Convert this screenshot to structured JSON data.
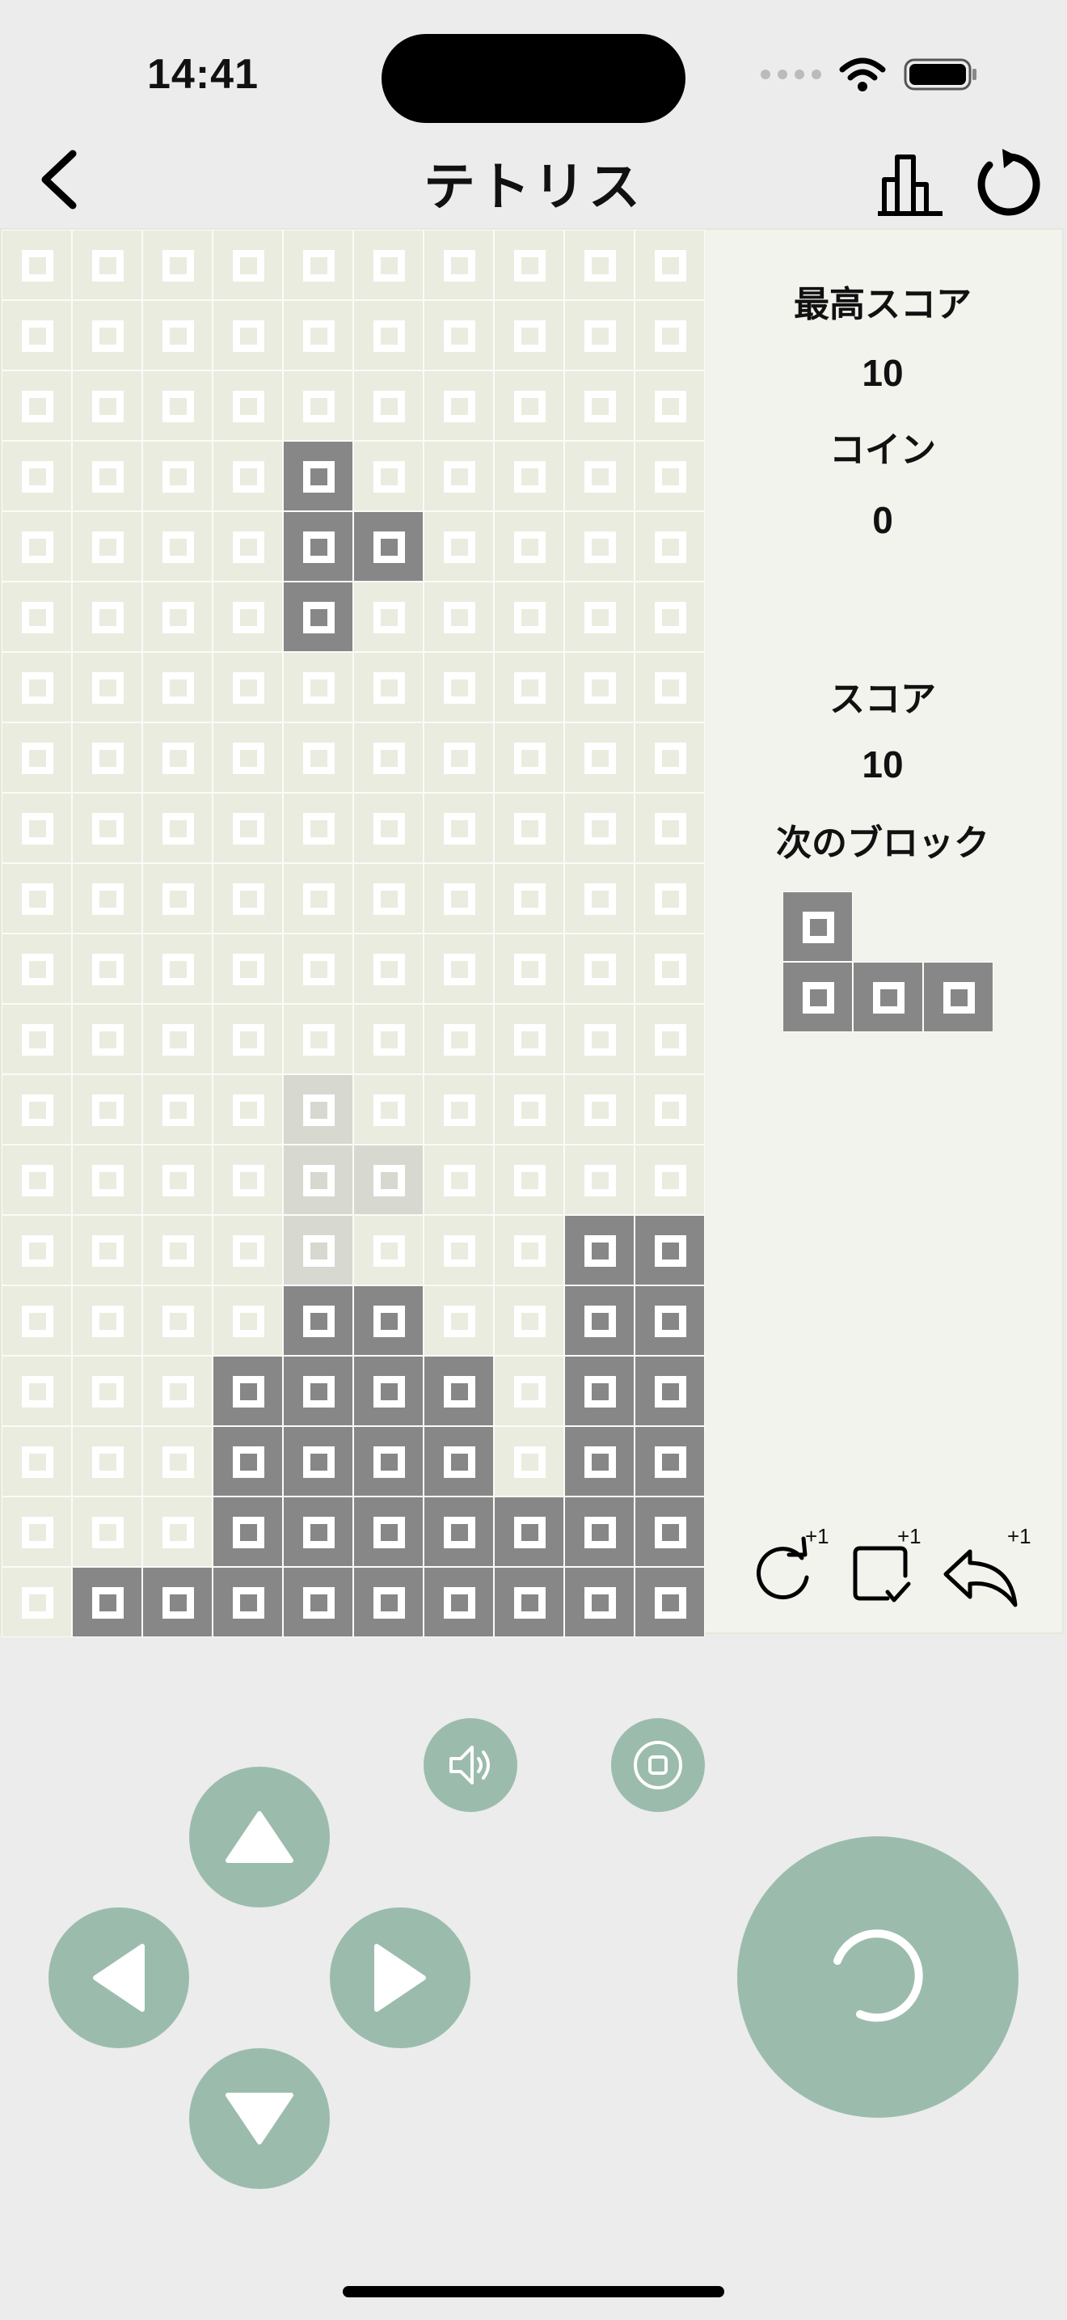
{
  "status": {
    "time": "14:41"
  },
  "nav": {
    "title": "テトリス",
    "back_icon": "chevron-left-icon",
    "stats_icon": "bar-chart-icon",
    "restart_icon": "restart-icon"
  },
  "side": {
    "best_label": "最高スコア",
    "best_value": "10",
    "coin_label": "コイン",
    "coin_value": "0",
    "score_label": "スコア",
    "score_value": "10",
    "next_label": "次のブロック"
  },
  "board": {
    "columns": 10,
    "rows": 20,
    "legend": {
      ".": "empty",
      "#": "filled",
      "g": "ghost"
    },
    "grid": [
      "..........",
      "..........",
      "..........",
      "....#.....",
      "....##....",
      "....#.....",
      "..........",
      "..........",
      "..........",
      "..........",
      "..........",
      "..........",
      "....g.....",
      "....gg....",
      "....g...##",
      "....##..##",
      "...####.##",
      "...####.##",
      "...#######",
      ".#########"
    ]
  },
  "next_piece": {
    "grid": [
      "#..",
      "###"
    ]
  },
  "powerups": [
    {
      "icon": "rotate-icon",
      "badge": "+1"
    },
    {
      "icon": "check-square-icon",
      "badge": "+1"
    },
    {
      "icon": "undo-icon",
      "badge": "+1"
    }
  ],
  "controls": {
    "sound_icon": "speaker-icon",
    "pause_icon": "stop-icon",
    "up_icon": "triangle-up-icon",
    "left_icon": "triangle-left-icon",
    "right_icon": "triangle-right-icon",
    "down_icon": "triangle-down-icon",
    "action_icon": "rotate-arc-icon"
  },
  "colors": {
    "filled": "#878787",
    "empty": "#e9ecdf",
    "ghost": "#d7d8cf",
    "control": "#9bbcad",
    "background": "#ececec"
  }
}
